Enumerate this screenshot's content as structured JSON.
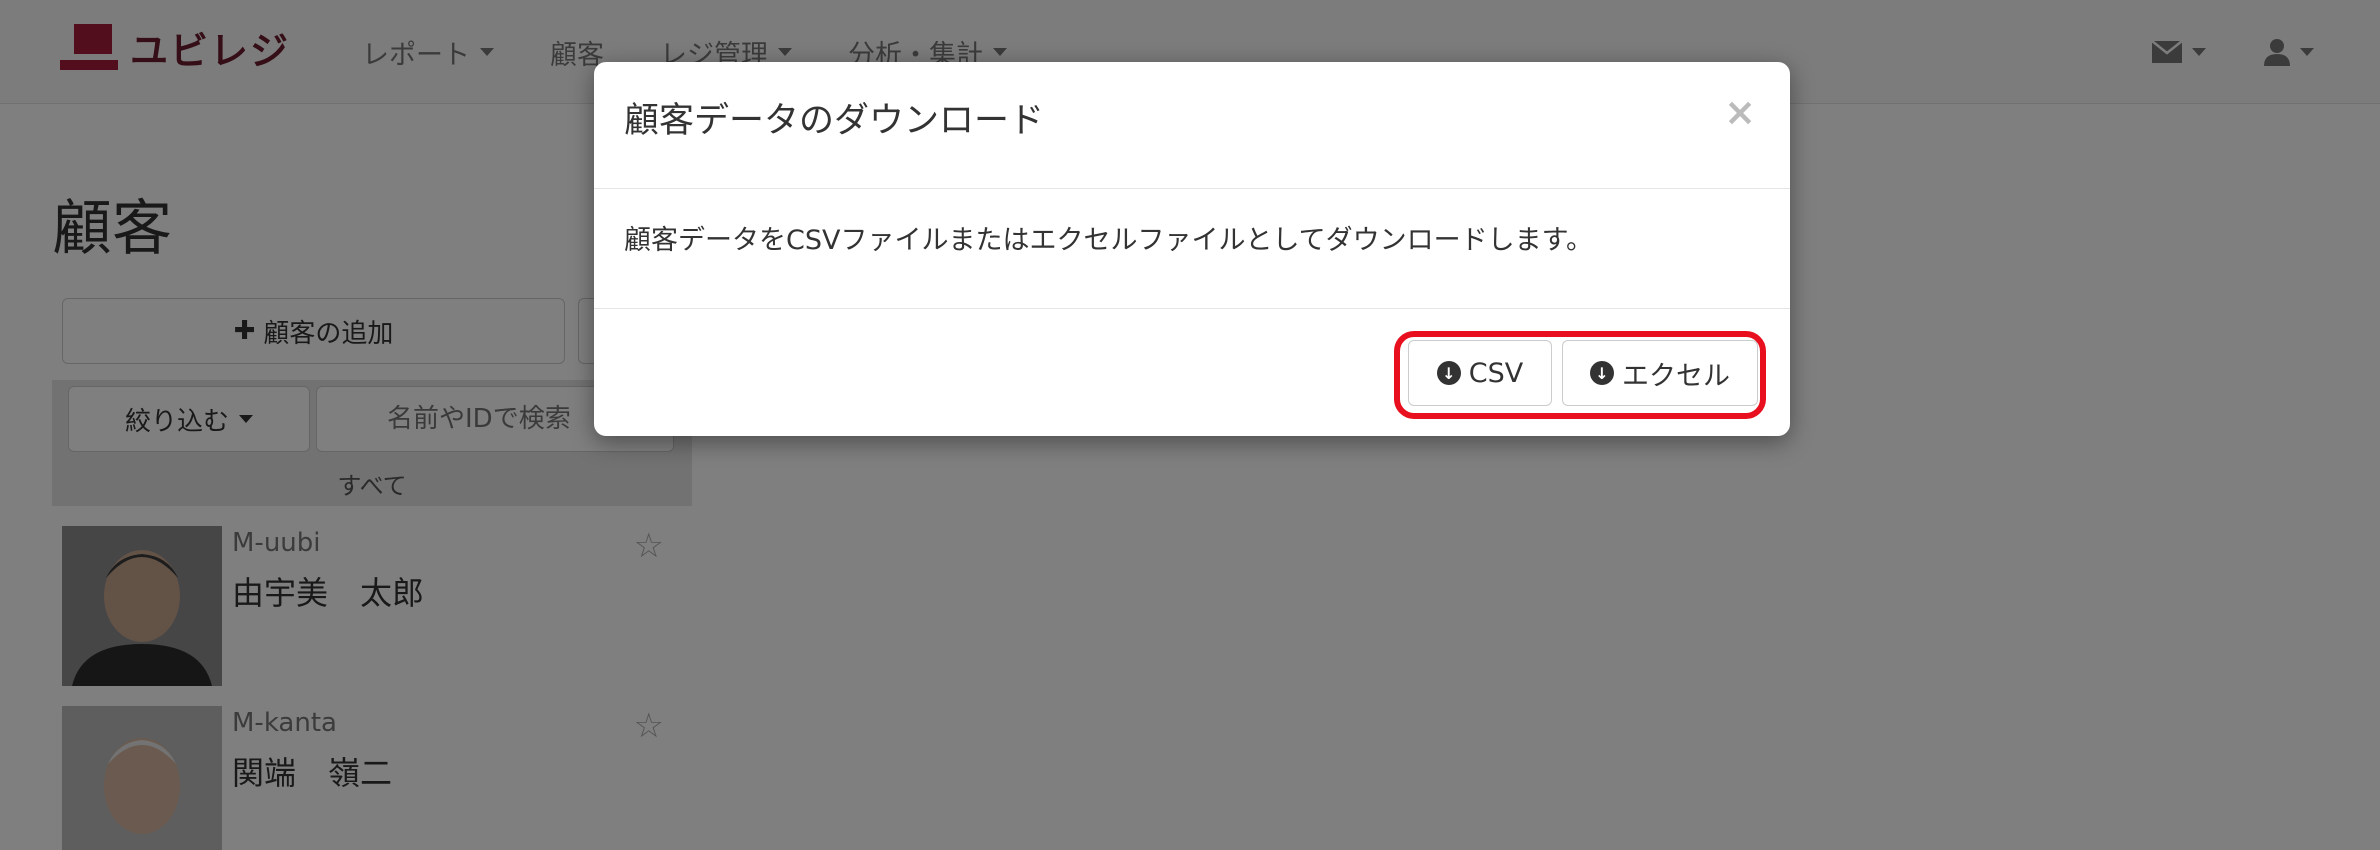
{
  "navbar": {
    "logo_text": "ユビレジ",
    "items": [
      {
        "label": "レポート",
        "dropdown": true
      },
      {
        "label": "顧客",
        "dropdown": false
      },
      {
        "label": "レジ管理",
        "dropdown": true
      },
      {
        "label": "分析・集計",
        "dropdown": true
      }
    ],
    "right_icons": [
      "envelope-icon",
      "user-icon"
    ]
  },
  "page": {
    "title": "顧客",
    "add_button_label": "顧客の追加",
    "filter_button_label": "絞り込む",
    "search_placeholder": "名前やIDで検索",
    "all_label": "すべて"
  },
  "customers": [
    {
      "id": "M-uubi",
      "name": "由宇美　太郎"
    },
    {
      "id": "M-kanta",
      "name": "関端　嶺二"
    }
  ],
  "modal": {
    "title": "顧客データのダウンロード",
    "close_label": "×",
    "body": "顧客データをCSVファイルまたはエクセルファイルとしてダウンロードします。",
    "csv_label": "CSV",
    "excel_label": "エクセル",
    "highlight_color": "#e8101e"
  }
}
